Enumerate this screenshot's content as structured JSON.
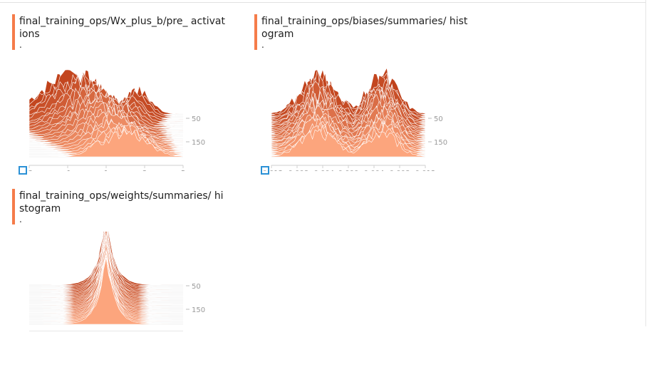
{
  "cards": [
    {
      "title": "final_training_ops/Wx_plus_b/pre_ activations",
      "subtitle": ".",
      "x_ticks": [
        "-3",
        "-1",
        "1",
        "3",
        "5"
      ],
      "y_ticks": [
        "50",
        "150"
      ],
      "shape": "wide"
    },
    {
      "title": "final_training_ops/biases/summaries/ histogram",
      "subtitle": ".",
      "x_ticks": [
        "-0.012",
        "-0.008",
        "-0.004",
        "0.000",
        "0.004",
        "0.008",
        "0.012"
      ],
      "y_ticks": [
        "50",
        "150"
      ],
      "shape": "split"
    },
    {
      "title": "final_training_ops/weights/summaries/ histogram",
      "subtitle": ".",
      "x_ticks": [],
      "y_ticks": [
        "50",
        "150"
      ],
      "shape": "peak"
    }
  ],
  "colors": {
    "accent": "#f57c4a",
    "ridge_dark": "#c0421b",
    "ridge_light": "#fca57d",
    "expand": "#2b91d6"
  }
}
